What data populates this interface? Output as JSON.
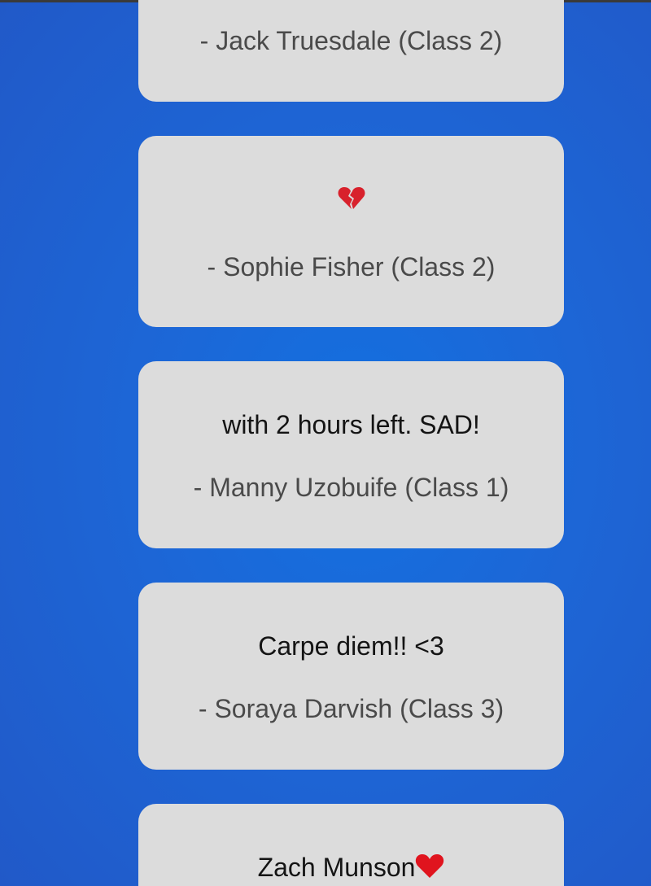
{
  "posts": [
    {
      "message": "",
      "author": "- Jack Truesdale (Class 2)"
    },
    {
      "message_icon": "broken-heart-icon",
      "author": "- Sophie Fisher (Class 2)"
    },
    {
      "message": "with 2 hours left. SAD!",
      "author": "- Manny Uzobuife (Class 1)"
    },
    {
      "message": "Carpe diem!! <3",
      "author": "- Soraya Darvish (Class 3)"
    },
    {
      "message": "Zach Munson",
      "message_icon": "red-heart-icon",
      "author": ""
    }
  ],
  "colors": {
    "background": "#1d66d6",
    "card": "#dcdcdc",
    "heart": "#e0141e"
  }
}
